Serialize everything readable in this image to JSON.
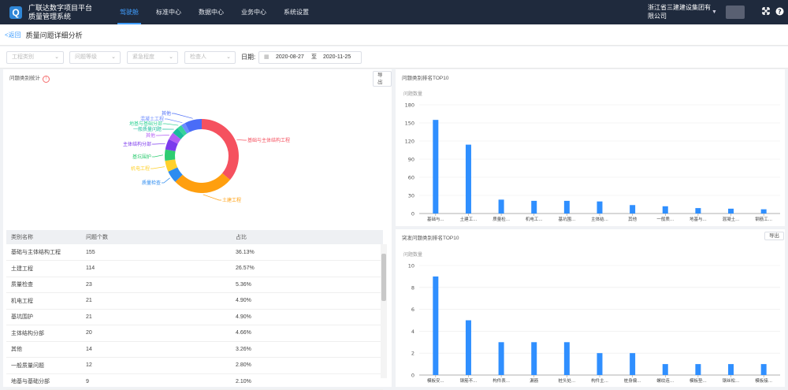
{
  "header": {
    "logo": "Q",
    "brand_line1": "广联达数字项目平台",
    "brand_line2": "质量管理系统",
    "nav": [
      {
        "label": "驾驶舱",
        "active": true
      },
      {
        "label": "标准中心",
        "active": false
      },
      {
        "label": "数据中心",
        "active": false
      },
      {
        "label": "业务中心",
        "active": false
      },
      {
        "label": "系统设置",
        "active": false
      }
    ],
    "company_line1": "浙江省三建建设集团有",
    "company_line2": "限公司"
  },
  "titlebar": {
    "back": "<返回",
    "title": "质量问题详细分析"
  },
  "filters": {
    "selects": [
      "工程类别",
      "问题等级",
      "紧急程度",
      "检查人"
    ],
    "date_label": "日期:",
    "date_start": "2020-08-27",
    "date_sep": "至",
    "date_end": "2020-11-25"
  },
  "donut_panel": {
    "title": "问题类别统计",
    "export_label": "导出"
  },
  "table": {
    "headers": [
      "类别名称",
      "问题个数",
      "占比"
    ],
    "rows": [
      [
        "基础与主体结构工程",
        "155",
        "36.13%"
      ],
      [
        "土建工程",
        "114",
        "26.57%"
      ],
      [
        "质量检查",
        "23",
        "5.36%"
      ],
      [
        "机电工程",
        "21",
        "4.90%"
      ],
      [
        "基坑围护",
        "21",
        "4.90%"
      ],
      [
        "主体结构分部",
        "20",
        "4.66%"
      ],
      [
        "其他",
        "14",
        "3.26%"
      ],
      [
        "一般质量问题",
        "12",
        "2.80%"
      ],
      [
        "地基与基础分部",
        "9",
        "2.10%"
      ]
    ]
  },
  "bar1_panel": {
    "title": "问题类别排名TOP10"
  },
  "bar2_panel": {
    "title": "突发问题类别排名TOP10",
    "export_label": "导出"
  },
  "chart_data": [
    {
      "type": "pie",
      "title": "问题类别统计",
      "categories": [
        "基础与主体结构工程",
        "土建工程",
        "质量检查",
        "机电工程",
        "基坑围护",
        "主体结构分部",
        "其他",
        "一般质量问题",
        "地基与基础分部",
        "混凝土工程",
        "其他"
      ],
      "values": [
        155,
        114,
        23,
        21,
        21,
        20,
        14,
        12,
        9,
        8,
        32
      ],
      "colors": [
        "#f5515f",
        "#ff9f0f",
        "#2d8cf0",
        "#ffd02b",
        "#2ecc71",
        "#7c3aed",
        "#b25ef5",
        "#1abc9c",
        "#36d399",
        "#6c8cff",
        "#4a6cf7"
      ]
    },
    {
      "type": "bar",
      "title": "问题类别排名TOP10",
      "ylabel": "问题数量",
      "ylim": [
        0,
        180
      ],
      "yticks": [
        0,
        30,
        60,
        90,
        120,
        150,
        180
      ],
      "categories": [
        "基础与...",
        "土建工...",
        "质量检...",
        "机电工...",
        "基坑围...",
        "主体结...",
        "其他",
        "一般质...",
        "地基与...",
        "混凝土...",
        "钢筋工..."
      ],
      "values": [
        155,
        114,
        23,
        21,
        21,
        20,
        14,
        12,
        9,
        8,
        7
      ]
    },
    {
      "type": "bar",
      "title": "突发问题类别排名TOP10",
      "ylabel": "问题数量",
      "ylim": [
        0,
        10
      ],
      "yticks": [
        0,
        2,
        4,
        6,
        8,
        10
      ],
      "categories": [
        "模板安...",
        "钢筋不...",
        "构件表...",
        "漏筋",
        "桩头处...",
        "构件主...",
        "桩身偏...",
        "螺纹连...",
        "模板垫...",
        "钢丝松...",
        "模板接..."
      ],
      "values": [
        9,
        5,
        3,
        3,
        3,
        2,
        2,
        1,
        1,
        1,
        1
      ]
    }
  ]
}
